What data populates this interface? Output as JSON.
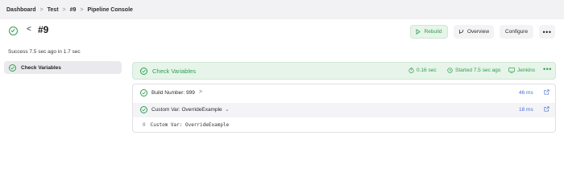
{
  "breadcrumbs": [
    "Dashboard",
    "Test",
    "#9",
    "Pipeline Console"
  ],
  "build": {
    "title": "#9",
    "status_text": "Success 7.5 sec ago in 1.7 sec"
  },
  "header_buttons": {
    "rebuild": "Rebuild",
    "overview": "Overview",
    "configure": "Configure",
    "more": "•••"
  },
  "sidebar": {
    "stages": [
      {
        "label": "Check Variables"
      }
    ]
  },
  "stage": {
    "title": "Check Variables",
    "duration": "0.16 sec",
    "started": "Started 7.5 sec ago",
    "agent": "Jenkins",
    "more": "•••"
  },
  "steps": [
    {
      "label": "Build Number: 999",
      "duration": "46 ms"
    },
    {
      "label": "Custom Var: OverrideExample",
      "duration": "18 ms"
    }
  ],
  "log": {
    "line_number": "0",
    "text": "Custom Var: OverrideExample"
  },
  "colors": {
    "success": "#2e9e4f",
    "success_bg": "#e6f4e9",
    "link": "#4a6fd0",
    "topbar_bg": "#f2f2f5"
  },
  "icons": [
    "success-check-icon",
    "back-chevron-icon",
    "play-icon",
    "branch-icon",
    "timer-icon",
    "clock-icon",
    "monitor-icon",
    "external-link-icon",
    "chevron-right-icon",
    "chevron-down-icon"
  ]
}
